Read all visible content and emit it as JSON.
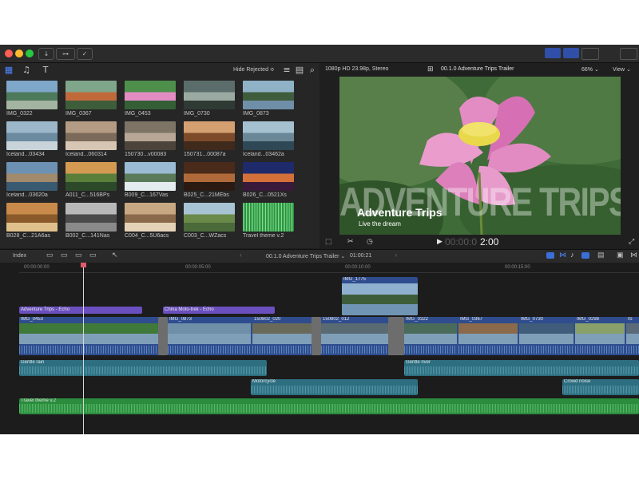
{
  "browser": {
    "filter_label": "Hide Rejected ≎",
    "clips": [
      {
        "name": "IMG_0322"
      },
      {
        "name": "IMG_0367"
      },
      {
        "name": "IMG_0453"
      },
      {
        "name": "IMG_0730"
      },
      {
        "name": "IMG_0873"
      },
      {
        "name": "Iceland...03434"
      },
      {
        "name": "Iceland...060314"
      },
      {
        "name": "150730...v00083"
      },
      {
        "name": "150731...00087a"
      },
      {
        "name": "Iceland...03462a"
      },
      {
        "name": "Iceland...03620a"
      },
      {
        "name": "A011_C...516BPs"
      },
      {
        "name": "B009_C...167Vas"
      },
      {
        "name": "B025_C...21MEbs"
      },
      {
        "name": "B026_C...0521Xs"
      },
      {
        "name": "B028_C...21A6as"
      },
      {
        "name": "B002_C...141Nas"
      },
      {
        "name": "C004_C...5U6acs"
      },
      {
        "name": "C003_C...WZacs"
      },
      {
        "name": "Travel theme v.2"
      }
    ]
  },
  "viewer": {
    "format": "1080p HD 23.98p, Stereo",
    "project_title": "00.1.0 Adventure Trips Trailer",
    "zoom": "66% ⌄",
    "view_menu": "View ⌄",
    "overlay_big": "ADVENTURE TRIPS",
    "overlay_title": "Adventure Trips",
    "overlay_subtitle": "Live the dream",
    "timecode_dim": "00:00:0",
    "timecode_bright": "2:00"
  },
  "timeline_bar": {
    "index_label": "Index",
    "project": "00.1.0 Adventure Trips Trailer ⌄",
    "duration": "01:00:21"
  },
  "ruler": {
    "marks": [
      "00:00:00:00",
      "00:00:05:00",
      "00:00:10:00",
      "00:00:15:00"
    ]
  },
  "tracks": {
    "connected_video": "IMG_1775",
    "voice1": "Adventure Trips - Echo",
    "voice2": "China Moto-trek - Echo",
    "primary": [
      "IMG_0453",
      "IMG_0873",
      "150802_020",
      "150802_012",
      "IMG_0322",
      "IMG_0367",
      "IMG_0730",
      "IMG_0298",
      "IS"
    ],
    "audio1": "Gentle rain",
    "audio2": "Gentle river",
    "audio3": "Motorcycle",
    "audio4": "Crowd noise",
    "music": "Travel theme v.2"
  },
  "colors": {
    "accent_blue": "#3b6fd8",
    "connected_purple": "#6a4fbf",
    "primary_blue": "#2f4d8e",
    "audio_teal": "#2d6f80",
    "music_green": "#2b8c3e",
    "playhead": "#e05a6a"
  }
}
